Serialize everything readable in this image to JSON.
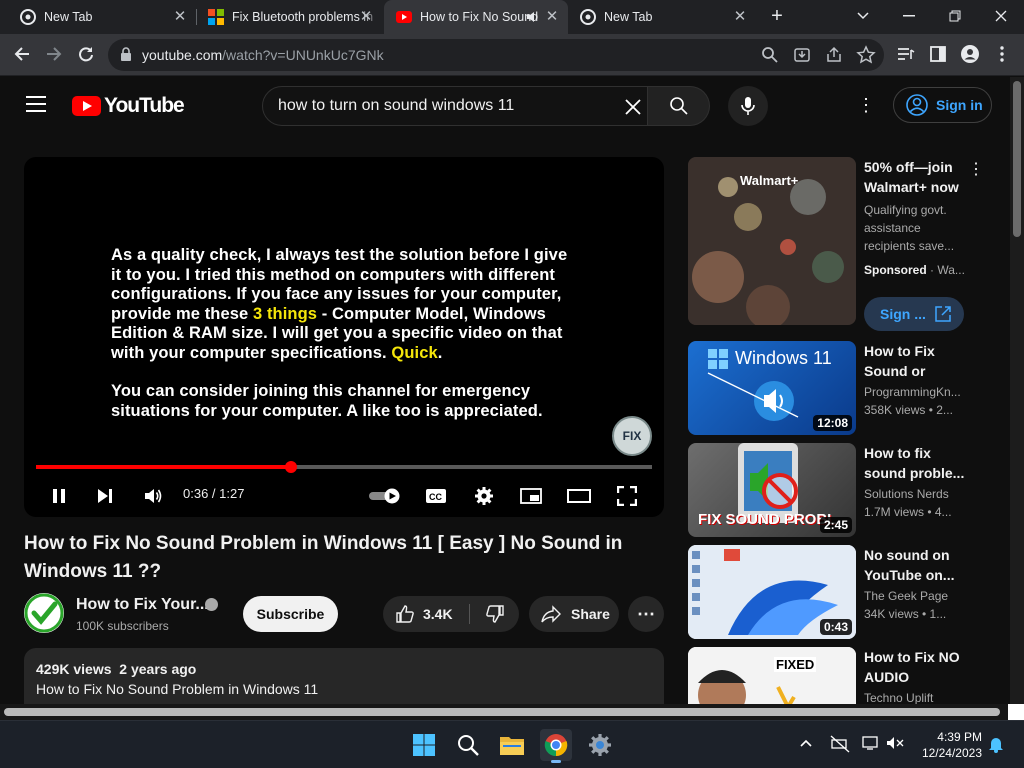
{
  "browser": {
    "tabs": [
      {
        "title": "New Tab",
        "favicon": "chrome-icon",
        "active": false
      },
      {
        "title": "Fix Bluetooth problems in",
        "favicon": "microsoft-icon",
        "active": false
      },
      {
        "title": "How to Fix No Sound",
        "favicon": "youtube-icon",
        "active": true,
        "audio": true
      },
      {
        "title": "New Tab",
        "favicon": "chrome-icon",
        "active": false
      }
    ],
    "url_host": "youtube.com",
    "url_path": "/watch?v=UNUnkUc7GNk"
  },
  "youtube": {
    "logo_text": "YouTube",
    "search_value": "how to turn on sound windows 11",
    "signin_label": "Sign in"
  },
  "player": {
    "caption_lines": {
      "p1a": "As a quality check, I always test the solution before I give it to you. I tried this method on computers with different configurations. If you face any issues for your computer, provide me these ",
      "p1_hl1": "3 things",
      "p1b": " - Computer Model, Windows Edition & RAM size. I will get you a specific video on that with your computer specifications. ",
      "p1_hl2": "Quick",
      "p1c": ".",
      "p2": "You can consider joining this channel for emergency situations for your computer. A like too is appreciated."
    },
    "watermark": "FIX",
    "time_text": "0:36 / 1:27",
    "progress_fraction": 0.4138,
    "colors": {
      "progress": "#ff0000",
      "highlight": "#f5e60a"
    }
  },
  "video": {
    "title": "How to Fix No Sound Problem in Windows 11 [ Easy ] No Sound in Windows 11 ??",
    "channel_name": "How to Fix Your...",
    "subscribers": "100K subscribers",
    "subscribe_label": "Subscribe",
    "likes": "3.4K",
    "share_label": "Share",
    "views": "429K views",
    "age": "2 years ago",
    "description_first_line": "How to Fix No Sound Problem in Windows 11"
  },
  "ad": {
    "thumb_brand": "Walmart+",
    "title": "50% off—join Walmart+ now",
    "description": "Qualifying govt. assistance recipients save...",
    "sponsored_label": "Sponsored",
    "sponsor_name": "Wa...",
    "cta_label": "Sign ..."
  },
  "recommendations": [
    {
      "title": "How to Fix Sound or Audi...",
      "channel": "ProgrammingKn...",
      "views": "358K views  • 2...",
      "duration": "12:08",
      "thumb_text": "Windows 11"
    },
    {
      "title": "How to fix sound proble...",
      "channel": "Solutions Nerds",
      "views": "1.7M views  • 4...",
      "duration": "2:45",
      "thumb_text": "FIX SOUND PROBL"
    },
    {
      "title": "No sound on YouTube on...",
      "channel": "The Geek Page",
      "views": "34K views  • 1...",
      "duration": "0:43",
      "thumb_text": ""
    },
    {
      "title": "How to Fix NO AUDIO Device...",
      "channel": "Techno Uplift",
      "views": "",
      "duration": "",
      "thumb_text": "FIXED"
    }
  ],
  "taskbar": {
    "time": "4:39 PM",
    "date": "12/24/2023"
  }
}
